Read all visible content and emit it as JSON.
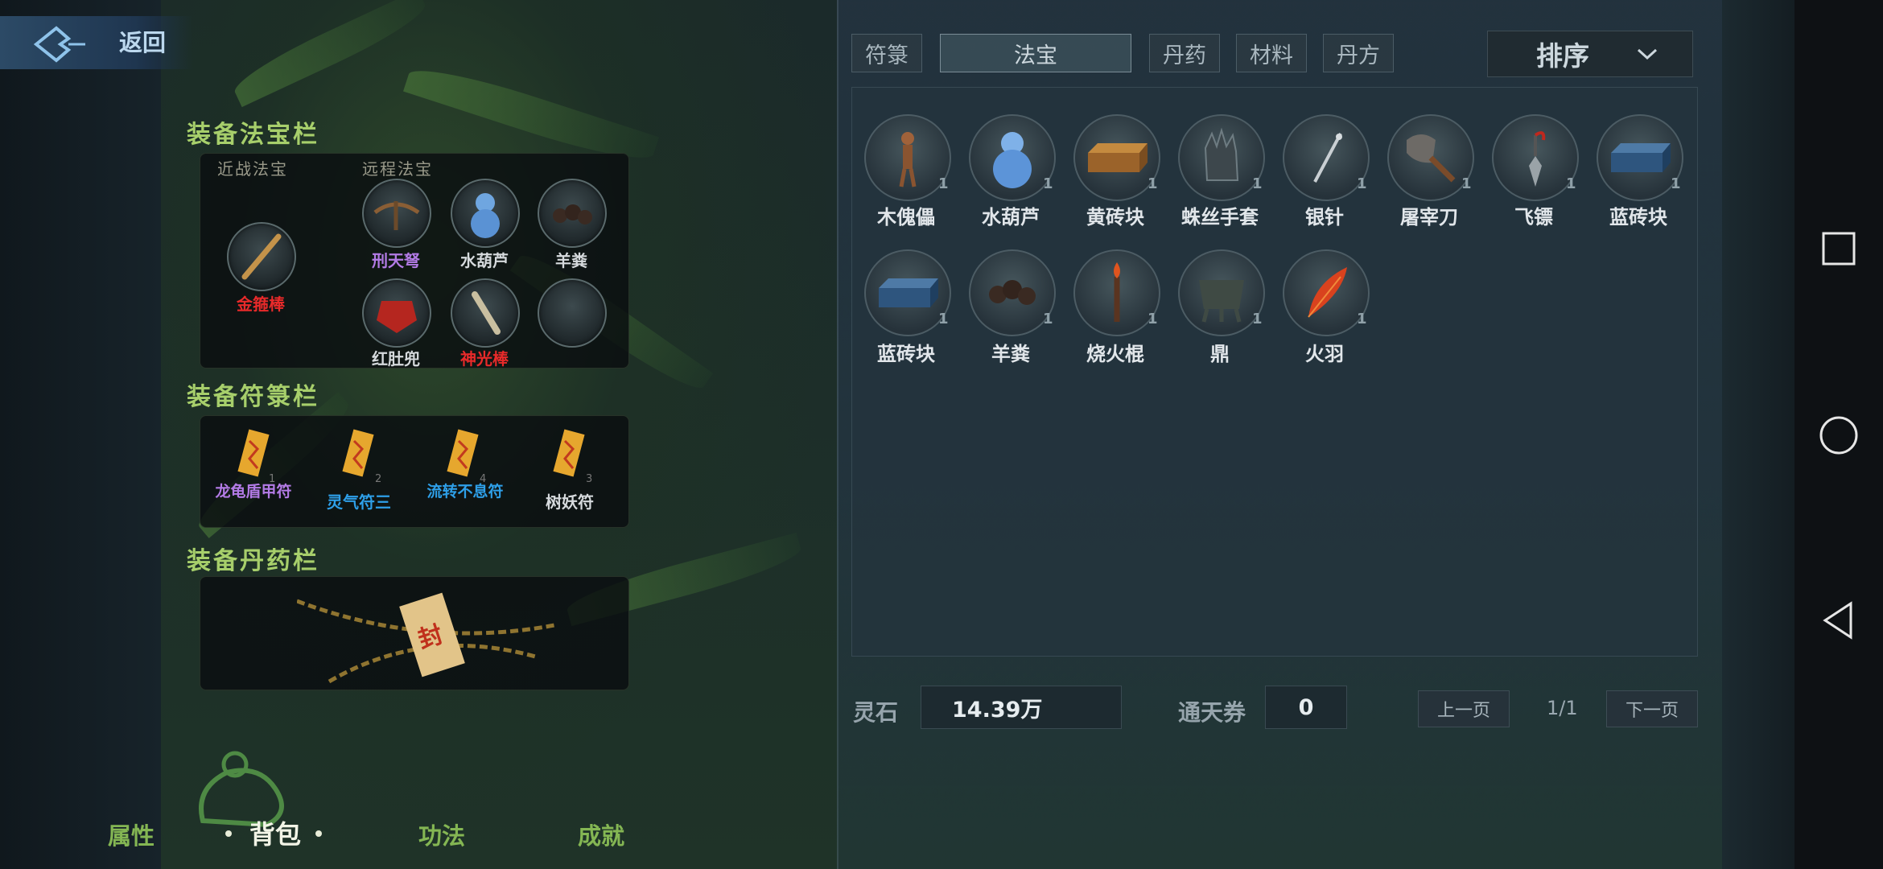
{
  "back": {
    "label": "返回"
  },
  "equip_treasure": {
    "title": "装备法宝栏",
    "melee_label": "近战法宝",
    "ranged_label": "远程法宝",
    "melee_slots": [
      {
        "name": "金箍棒",
        "color": "#e82a2a"
      }
    ],
    "ranged_slots": [
      {
        "name": "刑天弩",
        "color": "#b37be6"
      },
      {
        "name": "水葫芦",
        "color": "#d6dadd"
      },
      {
        "name": "羊粪",
        "color": "#d6dadd"
      },
      {
        "name": "红肚兜",
        "color": "#d6dadd"
      },
      {
        "name": "神光棒",
        "color": "#e82a2a"
      },
      {
        "name": "",
        "color": "#d6dadd"
      }
    ]
  },
  "equip_talisman": {
    "title": "装备符箓栏",
    "slots": [
      {
        "name": "龙龟盾甲符",
        "count": "1",
        "color": "#b37be6"
      },
      {
        "name": "灵气符三",
        "count": "2",
        "color": "#2e9fe8"
      },
      {
        "name": "流转不息符",
        "count": "4",
        "color": "#2e9fe8"
      },
      {
        "name": "树妖符",
        "count": "3",
        "color": "#d6dadd"
      }
    ]
  },
  "equip_pill": {
    "title": "装备丹药栏",
    "seal_char": "封"
  },
  "tabs": [
    {
      "label": "符箓",
      "active": false
    },
    {
      "label": "法宝",
      "active": true
    },
    {
      "label": "丹药",
      "active": false
    },
    {
      "label": "材料",
      "active": false
    },
    {
      "label": "丹方",
      "active": false
    }
  ],
  "sort": {
    "label": "排序"
  },
  "inventory": [
    {
      "name": "木傀儡",
      "count": "1",
      "icon": "wooden-puppet-icon"
    },
    {
      "name": "水葫芦",
      "count": "1",
      "icon": "water-gourd-icon"
    },
    {
      "name": "黄砖块",
      "count": "1",
      "icon": "yellow-brick-icon"
    },
    {
      "name": "蛛丝手套",
      "count": "1",
      "icon": "spider-glove-icon"
    },
    {
      "name": "银针",
      "count": "1",
      "icon": "silver-needle-icon"
    },
    {
      "name": "屠宰刀",
      "count": "1",
      "icon": "cleaver-icon"
    },
    {
      "name": "飞镖",
      "count": "1",
      "icon": "dart-icon"
    },
    {
      "name": "蓝砖块",
      "count": "1",
      "icon": "blue-brick-icon"
    },
    {
      "name": "蓝砖块",
      "count": "1",
      "icon": "blue-brick-icon"
    },
    {
      "name": "羊粪",
      "count": "1",
      "icon": "dung-icon"
    },
    {
      "name": "烧火棍",
      "count": "1",
      "icon": "fire-stick-icon"
    },
    {
      "name": "鼎",
      "count": "1",
      "icon": "cauldron-icon"
    },
    {
      "name": "火羽",
      "count": "1",
      "icon": "fire-feather-icon"
    }
  ],
  "footer": {
    "spirit_stone_label": "灵石",
    "spirit_stone_value": "14.39万",
    "ticket_label": "通天券",
    "ticket_value": "0",
    "prev_label": "上一页",
    "page": "1/1",
    "next_label": "下一页"
  },
  "bottom_tabs": [
    {
      "label": "属性",
      "active": false
    },
    {
      "label": "背包",
      "active": true
    },
    {
      "label": "功法",
      "active": false
    },
    {
      "label": "成就",
      "active": false
    }
  ]
}
